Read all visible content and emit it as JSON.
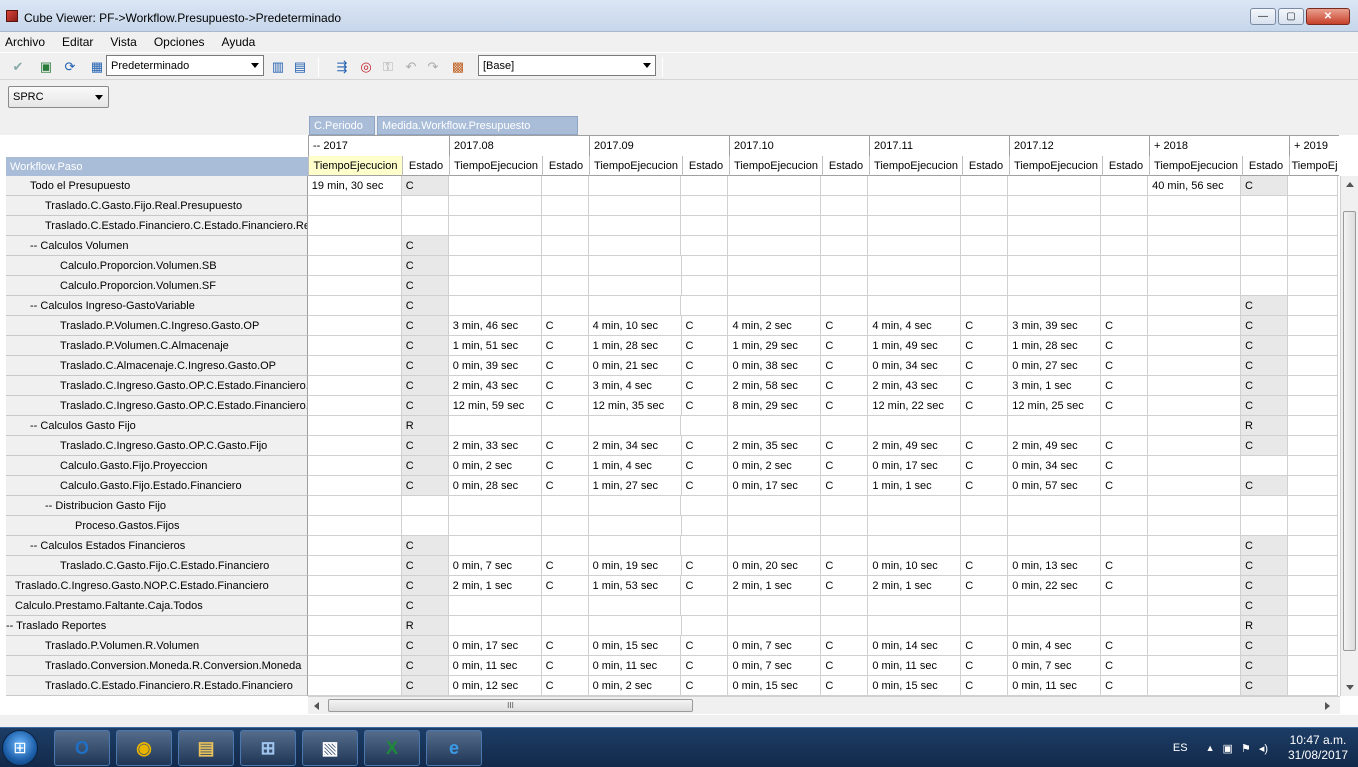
{
  "window": {
    "title": "Cube Viewer: PF->Workflow.Presupuesto->Predeterminado",
    "minimize": "—",
    "maximize": "▢",
    "close": "✕"
  },
  "menu": [
    "Archivo",
    "Editar",
    "Vista",
    "Opciones",
    "Ayuda"
  ],
  "toolbar": {
    "view_combo": "Predeterminado",
    "scenario_combo": "[Base]"
  },
  "filter": {
    "value": "SPRC"
  },
  "dimensions": {
    "column_1": "C.Periodo",
    "column_2": "Medida.Workflow.Presupuesto",
    "row_header": "Workflow.Paso"
  },
  "periods": [
    "-- 2017",
    "2017.08",
    "2017.09",
    "2017.10",
    "2017.11",
    "2017.12",
    "+ 2018",
    "+ 2019"
  ],
  "measures": [
    "TiempoEjecucion",
    "Estado",
    "TiempoEjecucion",
    "Estado",
    "TiempoEjecucion",
    "Estado",
    "TiempoEjecucion",
    "Estado",
    "TiempoEjecucion",
    "Estado",
    "TiempoEjecucion",
    "Estado",
    "TiempoEjecucion",
    "Estado",
    "TiempoEj"
  ],
  "rows": [
    {
      "label": "Todo el Presupuesto",
      "indent": 1,
      "cells": [
        "19 min, 30 sec",
        "C",
        "",
        "",
        "",
        "",
        "",
        "",
        "",
        "",
        "",
        "",
        "40 min, 56 sec",
        "C",
        ""
      ]
    },
    {
      "label": "Traslado.C.Gasto.Fijo.Real.Presupuesto",
      "indent": 2,
      "cells": [
        "",
        "",
        "",
        "",
        "",
        "",
        "",
        "",
        "",
        "",
        "",
        "",
        "",
        "",
        ""
      ]
    },
    {
      "label": "Traslado.C.Estado.Financiero.C.Estado.Financiero.Recalculo",
      "indent": 2,
      "cells": [
        "",
        "",
        "",
        "",
        "",
        "",
        "",
        "",
        "",
        "",
        "",
        "",
        "",
        "",
        ""
      ]
    },
    {
      "label": "-- Calculos Volumen",
      "indent": 1,
      "cells": [
        "",
        "C",
        "",
        "",
        "",
        "",
        "",
        "",
        "",
        "",
        "",
        "",
        "",
        "",
        ""
      ]
    },
    {
      "label": "Calculo.Proporcion.Volumen.SB",
      "indent": 3,
      "cells": [
        "",
        "C",
        "",
        "",
        "",
        "",
        "",
        "",
        "",
        "",
        "",
        "",
        "",
        "",
        ""
      ]
    },
    {
      "label": "Calculo.Proporcion.Volumen.SF",
      "indent": 3,
      "cells": [
        "",
        "C",
        "",
        "",
        "",
        "",
        "",
        "",
        "",
        "",
        "",
        "",
        "",
        "",
        ""
      ]
    },
    {
      "label": "-- Calculos Ingreso-GastoVariable",
      "indent": 1,
      "cells": [
        "",
        "C",
        "",
        "",
        "",
        "",
        "",
        "",
        "",
        "",
        "",
        "",
        "",
        "C",
        ""
      ]
    },
    {
      "label": "Traslado.P.Volumen.C.Ingreso.Gasto.OP",
      "indent": 3,
      "cells": [
        "",
        "C",
        "3 min, 46 sec",
        "C",
        "4 min, 10 sec",
        "C",
        "4 min, 2 sec",
        "C",
        "4 min, 4 sec",
        "C",
        "3 min, 39 sec",
        "C",
        "",
        "C",
        ""
      ]
    },
    {
      "label": "Traslado.P.Volumen.C.Almacenaje",
      "indent": 3,
      "cells": [
        "",
        "C",
        "1 min, 51 sec",
        "C",
        "1 min, 28 sec",
        "C",
        "1 min, 29 sec",
        "C",
        "1 min, 49 sec",
        "C",
        "1 min, 28 sec",
        "C",
        "",
        "C",
        ""
      ]
    },
    {
      "label": "Traslado.C.Almacenaje.C.Ingreso.Gasto.OP",
      "indent": 3,
      "cells": [
        "",
        "C",
        "0 min, 39 sec",
        "C",
        "0 min, 21 sec",
        "C",
        "0 min, 38 sec",
        "C",
        "0 min, 34 sec",
        "C",
        "0 min, 27 sec",
        "C",
        "",
        "C",
        ""
      ]
    },
    {
      "label": "Traslado.C.Ingreso.Gasto.OP.C.Estado.Financiero.I",
      "indent": 3,
      "cells": [
        "",
        "C",
        "2 min, 43 sec",
        "C",
        "3 min, 4 sec",
        "C",
        "2 min, 58 sec",
        "C",
        "2 min, 43 sec",
        "C",
        "3 min, 1 sec",
        "C",
        "",
        "C",
        ""
      ]
    },
    {
      "label": "Traslado.C.Ingreso.Gasto.OP.C.Estado.Financiero.G",
      "indent": 3,
      "cells": [
        "",
        "C",
        "12 min, 59 sec",
        "C",
        "12 min, 35 sec",
        "C",
        "8 min, 29 sec",
        "C",
        "12 min, 22 sec",
        "C",
        "12 min, 25 sec",
        "C",
        "",
        "C",
        ""
      ]
    },
    {
      "label": "-- Calculos Gasto Fijo",
      "indent": 1,
      "cells": [
        "",
        "R",
        "",
        "",
        "",
        "",
        "",
        "",
        "",
        "",
        "",
        "",
        "",
        "R",
        ""
      ]
    },
    {
      "label": "Traslado.C.Ingreso.Gasto.OP.C.Gasto.Fijo",
      "indent": 3,
      "cells": [
        "",
        "C",
        "2 min, 33 sec",
        "C",
        "2 min, 34 sec",
        "C",
        "2 min, 35 sec",
        "C",
        "2 min, 49 sec",
        "C",
        "2 min, 49 sec",
        "C",
        "",
        "C",
        ""
      ]
    },
    {
      "label": "Calculo.Gasto.Fijo.Proyeccion",
      "indent": 3,
      "cells": [
        "",
        "C",
        "0 min, 2 sec",
        "C",
        "1 min, 4 sec",
        "C",
        "0 min, 2 sec",
        "C",
        "0 min, 17 sec",
        "C",
        "0 min, 34 sec",
        "C",
        "",
        "",
        ""
      ]
    },
    {
      "label": "Calculo.Gasto.Fijo.Estado.Financiero",
      "indent": 3,
      "cells": [
        "",
        "C",
        "0 min, 28 sec",
        "C",
        "1 min, 27 sec",
        "C",
        "0 min, 17 sec",
        "C",
        "1 min, 1 sec",
        "C",
        "0 min, 57 sec",
        "C",
        "",
        "C",
        ""
      ]
    },
    {
      "label": "-- Distribucion Gasto Fijo",
      "indent": 2,
      "cells": [
        "",
        "",
        "",
        "",
        "",
        "",
        "",
        "",
        "",
        "",
        "",
        "",
        "",
        "",
        ""
      ]
    },
    {
      "label": "Proceso.Gastos.Fijos",
      "indent": 4,
      "cells": [
        "",
        "",
        "",
        "",
        "",
        "",
        "",
        "",
        "",
        "",
        "",
        "",
        "",
        "",
        ""
      ]
    },
    {
      "label": "-- Calculos Estados Financieros",
      "indent": 1,
      "cells": [
        "",
        "C",
        "",
        "",
        "",
        "",
        "",
        "",
        "",
        "",
        "",
        "",
        "",
        "C",
        ""
      ]
    },
    {
      "label": "Traslado.C.Gasto.Fijo.C.Estado.Financiero",
      "indent": 3,
      "cells": [
        "",
        "C",
        "0 min, 7 sec",
        "C",
        "0 min, 19 sec",
        "C",
        "0 min, 20 sec",
        "C",
        "0 min, 10 sec",
        "C",
        "0 min, 13 sec",
        "C",
        "",
        "C",
        ""
      ]
    },
    {
      "label": "Traslado.C.Ingreso.Gasto.NOP.C.Estado.Financiero",
      "indent": 0,
      "cells": [
        "",
        "C",
        "2 min, 1 sec",
        "C",
        "1 min, 53 sec",
        "C",
        "2 min, 1 sec",
        "C",
        "2 min, 1 sec",
        "C",
        "0 min, 22 sec",
        "C",
        "",
        "C",
        ""
      ]
    },
    {
      "label": "Calculo.Prestamo.Faltante.Caja.Todos",
      "indent": 0,
      "cells": [
        "",
        "C",
        "",
        "",
        "",
        "",
        "",
        "",
        "",
        "",
        "",
        "",
        "",
        "C",
        ""
      ]
    },
    {
      "label": "-- Traslado Reportes",
      "indent": -1,
      "cells": [
        "",
        "R",
        "",
        "",
        "",
        "",
        "",
        "",
        "",
        "",
        "",
        "",
        "",
        "R",
        ""
      ]
    },
    {
      "label": "Traslado.P.Volumen.R.Volumen",
      "indent": 2,
      "cells": [
        "",
        "C",
        "0 min, 17 sec",
        "C",
        "0 min, 15 sec",
        "C",
        "0 min, 7 sec",
        "C",
        "0 min, 14 sec",
        "C",
        "0 min, 4 sec",
        "C",
        "",
        "C",
        ""
      ]
    },
    {
      "label": "Traslado.Conversion.Moneda.R.Conversion.Moneda",
      "indent": 2,
      "cells": [
        "",
        "C",
        "0 min, 11 sec",
        "C",
        "0 min, 11 sec",
        "C",
        "0 min, 7 sec",
        "C",
        "0 min, 11 sec",
        "C",
        "0 min, 7 sec",
        "C",
        "",
        "C",
        ""
      ]
    },
    {
      "label": "Traslado.C.Estado.Financiero.R.Estado.Financiero",
      "indent": 2,
      "cells": [
        "",
        "C",
        "0 min, 12 sec",
        "C",
        "0 min, 2 sec",
        "C",
        "0 min, 15 sec",
        "C",
        "0 min, 15 sec",
        "C",
        "0 min, 11 sec",
        "C",
        "",
        "C",
        ""
      ]
    }
  ],
  "hscroll_grip": "III",
  "taskbar": {
    "apps": [
      {
        "name": "outlook-icon",
        "glyph": "O",
        "color": "#1f6fc5"
      },
      {
        "name": "chrome-icon",
        "glyph": "◉",
        "color": "#e8b400"
      },
      {
        "name": "file-explorer-icon",
        "glyph": "▤",
        "color": "#e8c25a"
      },
      {
        "name": "cube-app-icon",
        "glyph": "⊞",
        "color": "#9fc4ee"
      },
      {
        "name": "cube-viewer-icon",
        "glyph": "▧",
        "color": "#ffffff"
      },
      {
        "name": "excel-icon",
        "glyph": "X",
        "color": "#1f8a3a"
      },
      {
        "name": "internet-explorer-icon",
        "glyph": "e",
        "color": "#3b9ae8"
      }
    ],
    "language": "ES",
    "time": "10:47 a.m.",
    "date": "31/08/2017"
  }
}
